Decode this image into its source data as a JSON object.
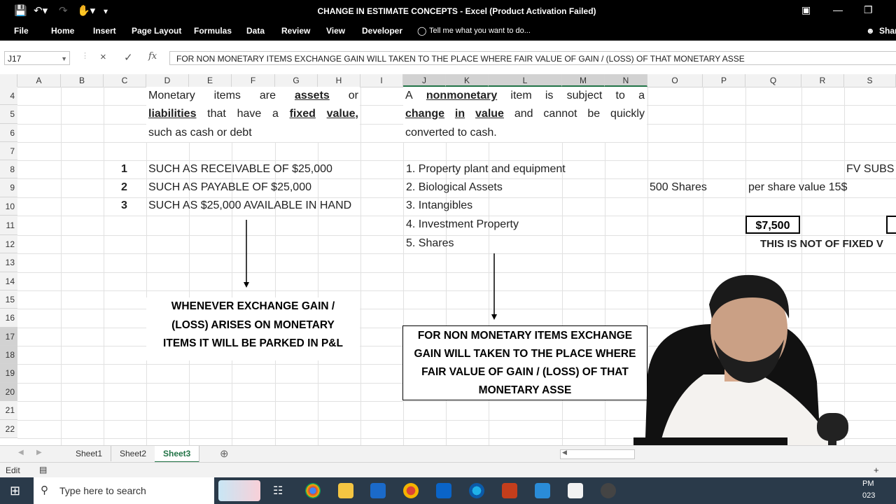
{
  "window": {
    "title": "CHANGE IN ESTIMATE CONCEPTS - Excel (Product Activation Failed)",
    "share_label": "Shar"
  },
  "ribbon": {
    "tabs": [
      "File",
      "Home",
      "Insert",
      "Page Layout",
      "Formulas",
      "Data",
      "Review",
      "View",
      "Developer"
    ],
    "tell_me": "Tell me what you want to do..."
  },
  "formula_bar": {
    "name_box": "J17",
    "cancel": "×",
    "enter": "✓",
    "fx": "fx",
    "content": "FOR NON MONETARY ITEMS EXCHANGE GAIN WILL TAKEN TO THE PLACE WHERE FAIR VALUE OF GAIN / (LOSS) OF THAT MONETARY ASSE"
  },
  "columns": [
    "A",
    "B",
    "C",
    "D",
    "E",
    "F",
    "G",
    "H",
    "I",
    "J",
    "K",
    "L",
    "M",
    "N",
    "O",
    "P",
    "Q",
    "R",
    "S"
  ],
  "rows": [
    "4",
    "5",
    "6",
    "7",
    "8",
    "9",
    "10",
    "11",
    "12",
    "13",
    "14",
    "15",
    "16",
    "17",
    "18",
    "19",
    "20",
    "21",
    "22"
  ],
  "sheet": {
    "monetary_def": {
      "line1_a": "Monetary",
      "line1_b": "items",
      "line1_c": "are",
      "line1_d": "assets",
      "line1_e": "or",
      "line2_a": "liabilities",
      "line2_b": "that",
      "line2_c": "have",
      "line2_d": "a",
      "line2_e": "fixed",
      "line2_f": "value,",
      "line3": "such as cash or debt"
    },
    "nonmonetary_def": {
      "line1_a": "A",
      "line1_b": "nonmonetary",
      "line1_c": "item",
      "line1_d": "is",
      "line1_e": "subject",
      "line1_f": "to",
      "line1_g": "a",
      "line2_a": "change",
      "line2_b": "in",
      "line2_c": "value",
      "line2_d": "and",
      "line2_e": "cannot",
      "line2_f": "be",
      "line2_g": "quickly",
      "line3": "converted to cash."
    },
    "monetary_examples": [
      {
        "num": "1",
        "text": "SUCH AS RECEIVABLE OF $25,000"
      },
      {
        "num": "2",
        "text": "SUCH AS PAYABLE OF $25,000"
      },
      {
        "num": "3",
        "text": "SUCH AS $25,000 AVAILABLE IN HAND"
      }
    ],
    "nonmonetary_examples": [
      "1. Property plant and equipment",
      "2. Biological Assets",
      "3. Intangibles",
      "4. Investment Property",
      "5. Shares"
    ],
    "shares_count": "500 Shares",
    "per_share": "per share value 15$",
    "fv_subs": "FV SUBS",
    "total_value": "$7,500",
    "not_fixed": "THIS IS NOT OF FIXED V",
    "monetary_note": [
      "WHENEVER EXCHANGE GAIN /",
      "(LOSS) ARISES ON MONETARY",
      "ITEMS IT WILL BE PARKED IN P&L"
    ],
    "nonmonetary_note": [
      "FOR NON MONETARY ITEMS EXCHANGE",
      "GAIN WILL TAKEN TO THE PLACE WHERE",
      "FAIR VALUE OF GAIN / (LOSS) OF THAT",
      "MONETARY ASSE"
    ]
  },
  "sheet_tabs": [
    "Sheet1",
    "Sheet2",
    "Sheet3"
  ],
  "active_sheet": "Sheet3",
  "status": {
    "mode": "Edit"
  },
  "taskbar": {
    "search_placeholder": "Type here to search",
    "clock_time": "PM",
    "clock_date": "023"
  },
  "colors": {
    "excel_green": "#217346",
    "title_bg": "#000000",
    "taskbar": "#2a3a4a"
  }
}
